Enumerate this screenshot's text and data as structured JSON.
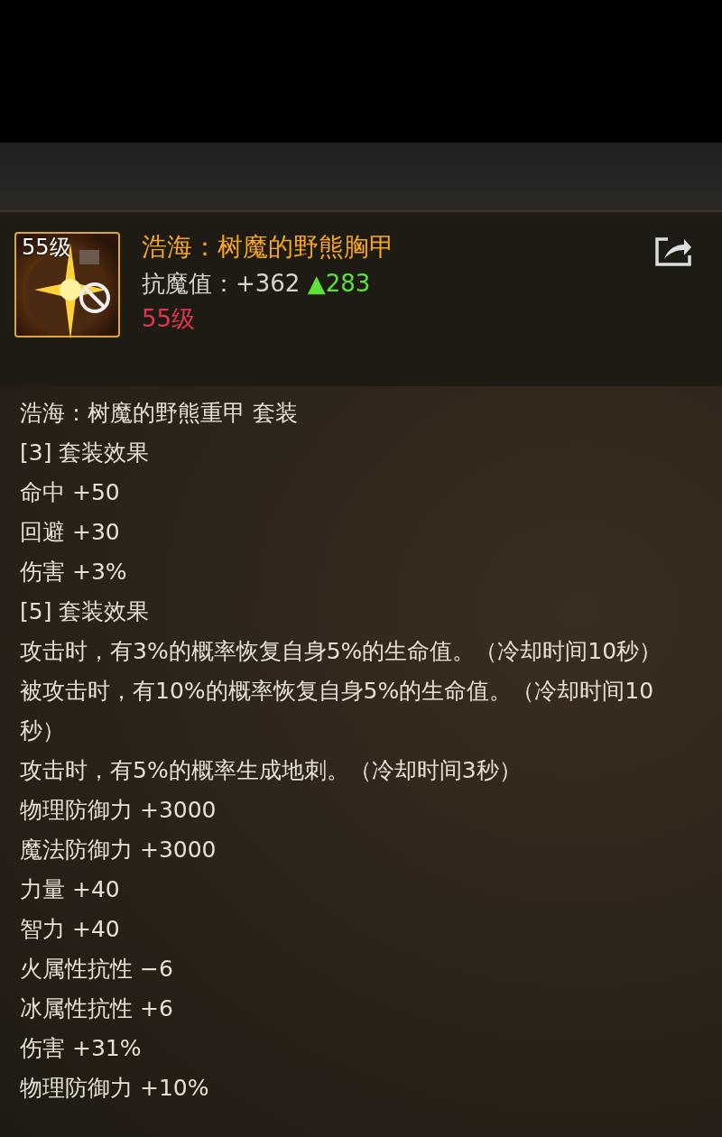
{
  "item": {
    "level_badge": "55级",
    "name": "浩海：树魔的野熊胸甲",
    "stat_label": "抗魔值：+362",
    "stat_increase": "▲283",
    "required_level": "55级"
  },
  "description": [
    "浩海：树魔的野熊重甲 套装",
    "[3] 套装效果",
    "命中 +50",
    "回避 +30",
    "伤害 +3%",
    "[5] 套装效果",
    "攻击时，有3%的概率恢复自身5%的生命值。（冷却时间10秒）",
    "被攻击时，有10%的概率恢复自身5%的生命值。（冷却时间10秒）",
    "攻击时，有5%的概率生成地刺。（冷却时间3秒）",
    "物理防御力 +3000",
    "魔法防御力 +3000",
    "力量 +40",
    "智力 +40",
    "火属性抗性 −6",
    "冰属性抗性 +6",
    "伤害 +31%",
    "物理防御力 +10%"
  ]
}
